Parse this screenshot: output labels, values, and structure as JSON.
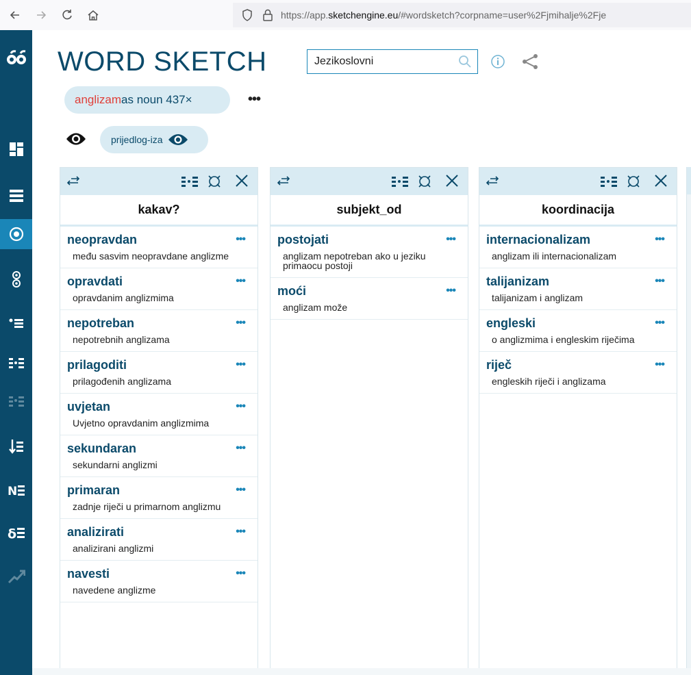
{
  "browser": {
    "url_prefix": "https://app.",
    "url_domain": "sketchengine.eu",
    "url_suffix": "/#wordsketch?corpname=user%2Fjmihalje%2Fje"
  },
  "header": {
    "title": "WORD SKETCH",
    "search_value": "Jezikoslovni"
  },
  "query_chip": {
    "lemma": "anglizam",
    "rest": " as noun 437×"
  },
  "filter": {
    "label": "prijedlog-iza"
  },
  "panels": [
    {
      "title": "kakav?",
      "rows": [
        {
          "word": "neopravdan",
          "example": "među sasvim neopravdane anglizme"
        },
        {
          "word": "opravdati",
          "example": "opravdanim anglizmima"
        },
        {
          "word": "nepotreban",
          "example": "nepotrebnih anglizama"
        },
        {
          "word": "prilagoditi",
          "example": "prilagođenih anglizama"
        },
        {
          "word": "uvjetan",
          "example": "Uvjetno opravdanim anglizmima"
        },
        {
          "word": "sekundaran",
          "example": "sekundarni anglizmi"
        },
        {
          "word": "primaran",
          "example": "zadnje riječi u primarnom anglizmu"
        },
        {
          "word": "analizirati",
          "example": "analizirani anglizmi"
        },
        {
          "word": "navesti",
          "example": "navedene anglizme"
        }
      ]
    },
    {
      "title": "subjekt_od",
      "rows": [
        {
          "word": "postojati",
          "example": "anglizam nepotreban ako u jeziku primaocu postoji"
        },
        {
          "word": "moći",
          "example": "anglizam može"
        }
      ]
    },
    {
      "title": "koordinacija",
      "rows": [
        {
          "word": "internacionalizam",
          "example": "anglizam ili internacionalizam"
        },
        {
          "word": "talijanizam",
          "example": "talijanizam i anglizam"
        },
        {
          "word": "engleski",
          "example": "o anglizmima i engleskim riječima"
        },
        {
          "word": "riječ",
          "example": "engleskih riječi i anglizama"
        }
      ]
    }
  ],
  "icons": {
    "sidebar": [
      "dashboard-icon",
      "list-icon",
      "target-icon",
      "thesaurus-icon",
      "bullet-list-icon",
      "columns-icon",
      "columns-dim-icon",
      "sort-icon",
      "ngram-icon",
      "keyword-icon",
      "trends-icon"
    ]
  },
  "colors": {
    "brand_dark": "#0b4a6a",
    "accent": "#1a86b8",
    "chip_bg": "#d9ebf3",
    "lemma_red": "#e0403a"
  }
}
